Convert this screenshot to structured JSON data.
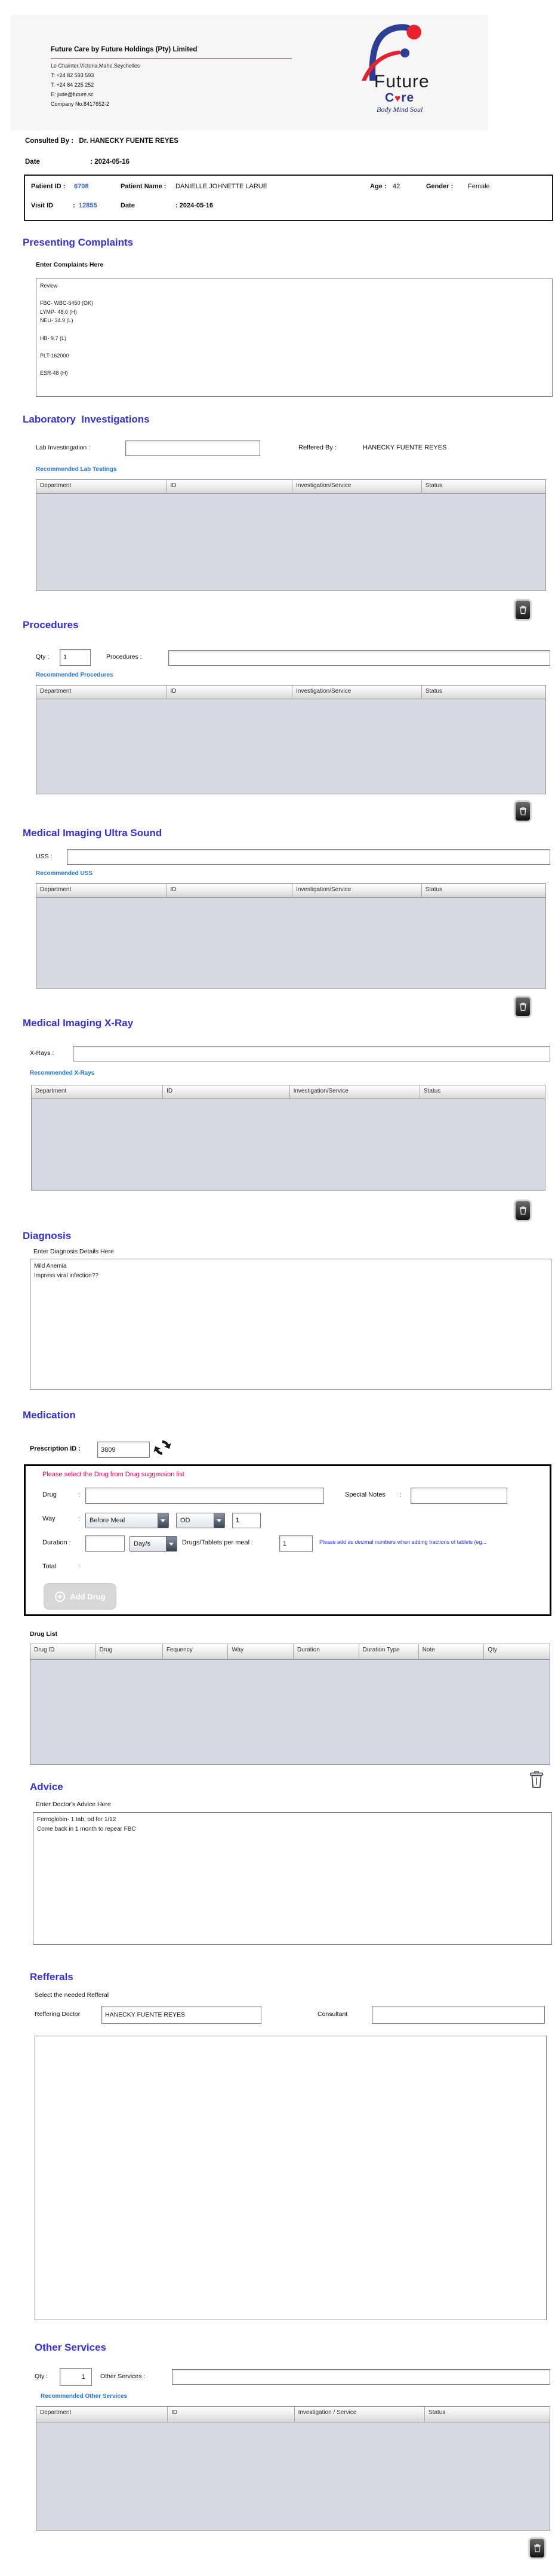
{
  "header": {
    "company_name": "Future Care by Future Holdings (Pty) Limited",
    "address": "Le Chainter,Victoria,Mahe,Seychelles",
    "phone1": "T: +24  82 593 593",
    "phone2": "T: +24  84 225 252",
    "email": "E: jude@future.sc",
    "company_no": "Company No.8417652-2",
    "logo": {
      "word1": "Future",
      "care_c": "C",
      "heart": "♥",
      "care_re": "re",
      "tagline": "Body Mind Soul"
    }
  },
  "consultation": {
    "consulted_by_label": "Consulted By :",
    "consulted_by": "Dr.  HANECKY FUENTE REYES",
    "date_label": "Date",
    "date_value": ": 2024-05-16"
  },
  "patient": {
    "patient_id_label": "Patient ID :",
    "patient_id": "6708",
    "patient_name_label": "Patient Name :",
    "patient_name": "DANIELLE JOHNETTE LARUE",
    "age_label": "Age :",
    "age": "42",
    "gender_label": "Gender  :",
    "gender": "Female",
    "visit_id_label": "Visit ID",
    "visit_colon": ":",
    "visit_id": "12855",
    "visit_date_label": "Date",
    "visit_date_value": ": 2024-05-16"
  },
  "presenting_complaints": {
    "title": "Presenting Complaints",
    "label": "Enter Complaints Here",
    "text": "Review\n\nFBC- WBC-5450 (OK)\nLYMP- 48.0 (H)\nNEU- 34.9 (L)\n\nHB- 9.7 (L)\n\nPLT-162000\n\nESR-48 (H)"
  },
  "laboratory": {
    "title": "Laboratory  Investigations",
    "input_label": "Lab Investingation :",
    "input_value": "",
    "referred_by_label": "Reffered By :",
    "referred_by": "HANECKY FUENTE REYES",
    "recommended_label": "Recommended Lab Testings",
    "table_headers": [
      "Department",
      "ID",
      "Investigation/Service",
      "Status"
    ]
  },
  "procedures": {
    "title": "Procedures",
    "qty_label": "Qty :",
    "qty": "1",
    "input_label": "Procedures :",
    "input_value": "",
    "recommended_label": "Recommended Procedures",
    "table_headers": [
      "Department",
      "ID",
      "Investigation/Service",
      "Status"
    ]
  },
  "ultrasound": {
    "title": "Medical Imaging Ultra Sound",
    "input_label": "USS :",
    "input_value": "",
    "recommended_label": "Recommended USS",
    "table_headers": [
      "Department",
      "ID",
      "Investigation/Service",
      "Status"
    ]
  },
  "xray": {
    "title": "Medical Imaging X-Ray",
    "input_label": "X-Rays :",
    "input_value": "",
    "recommended_label": "Recommended X-Rays",
    "table_headers": [
      "Department",
      "ID",
      "Investigation/Service",
      "Status"
    ]
  },
  "diagnosis": {
    "title": "Diagnosis",
    "label": "Enter Diagnosis Details Here",
    "text": "Mild Anemia\nImpress viral infection??"
  },
  "medication": {
    "title": "Medication",
    "prescription_id_label": "Prescription ID :",
    "prescription_id": "3809",
    "hint": "Please select the Drug from Drug suggession list",
    "drug_label": "Drug",
    "colon": ":",
    "drug_value": "",
    "special_notes_label": "Special Notes",
    "special_notes_value": "",
    "way_label": "Way",
    "way_value": "Before Meal",
    "frequency_value": "OD",
    "way_qty": "1",
    "duration_label": "Duration :",
    "duration_value": "",
    "duration_type_value": "Day/s",
    "per_meal_label": "Drugs/Tablets per meal :",
    "per_meal_value": "1",
    "note": "Please add as decimal numbers when adding fractions of tablets (eg...",
    "total_label": "Total",
    "add_drug_label": "Add Drug",
    "drug_list_label": "Drug List",
    "drug_table_headers": [
      "Drug ID",
      "Drug",
      "Fequency",
      "Way",
      "Duration",
      "Duration Type",
      "Note",
      "Qty"
    ]
  },
  "advice": {
    "title": "Advice",
    "label": "Enter Doctor's Advice Here",
    "text": "Ferroglobin- 1 tab, od for 1/12\nCome back in 1 month to repear FBC"
  },
  "referrals": {
    "title": "Refferals",
    "label": "Select the needed Refferal",
    "referring_doctor_label": "Reffering Doctor",
    "referring_doctor": "HANECKY FUENTE REYES",
    "consultant_label": "Consultant",
    "consultant": ""
  },
  "other_services": {
    "title": "Other Services",
    "qty_label": "Qty :",
    "qty": "1",
    "input_label": "Other Services :",
    "input_value": "",
    "recommended_label": "Recommended Other Services",
    "table_headers": [
      "Department",
      "ID",
      "Investigation / Service",
      "Status"
    ]
  },
  "colors": {
    "section_title": "#3431d8",
    "link_blue": "#2277e0",
    "id_blue": "#3a63d8",
    "hint_red": "#e0004d",
    "note_blue": "#2440dd",
    "table_body": "#d5d9e1",
    "logo_blue": "#2d3e96",
    "logo_red": "#e8212e"
  }
}
